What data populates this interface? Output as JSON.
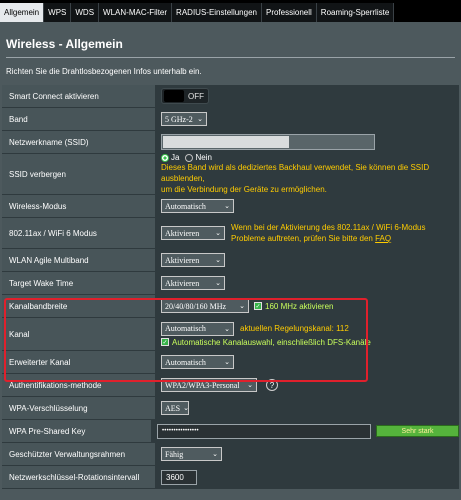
{
  "tabs": [
    "Allgemein",
    "WPS",
    "WDS",
    "WLAN-MAC-Filter",
    "RADIUS-Einstellungen",
    "Professionell",
    "Roaming-Sperrliste"
  ],
  "header": {
    "title": "Wireless - Allgemein",
    "description": "Richten Sie die Drahtlosbezogenen Infos unterhalb ein."
  },
  "rows": {
    "smart_connect": {
      "label": "Smart Connect aktivieren",
      "toggle": "OFF"
    },
    "band": {
      "label": "Band",
      "value": "5 GHz-2"
    },
    "ssid": {
      "label": "Netzwerkname (SSID)",
      "value": ""
    },
    "ssid_hide": {
      "label": "SSID verbergen",
      "opt_ja": "Ja",
      "opt_nein": "Nein",
      "note1": "Dieses Band wird als dediziertes Backhaul verwendet, Sie können die SSID ausblenden,",
      "note2": "um die Verbindung der Geräte zu ermöglichen."
    },
    "wireless_mode": {
      "label": "Wireless-Modus",
      "value": "Automatisch"
    },
    "ax_mode": {
      "label": "802.11ax / WiFi 6 Modus",
      "value": "Aktivieren",
      "note1": "Wenn bei der Aktivierung des 802.11ax / WiFi 6-Modus",
      "note2": "Probleme auftreten, prüfen Sie bitte den ",
      "faq": "FAQ"
    },
    "agile": {
      "label": "WLAN Agile Multiband",
      "value": "Aktivieren"
    },
    "twt": {
      "label": "Target Wake Time",
      "value": "Aktivieren"
    },
    "bandwidth": {
      "label": "Kanalbandbreite",
      "value": "20/40/80/160 MHz",
      "check": "160 MHz aktivieren"
    },
    "channel": {
      "label": "Kanal",
      "value": "Automatisch",
      "info": "aktuellen Regelungskanal: 112",
      "check": "Automatische Kanalauswahl, einschließlich DFS-Kanäle"
    },
    "ext_channel": {
      "label": "Erweiterter Kanal",
      "value": "Automatisch"
    },
    "auth": {
      "label": "Authentifikations-methode",
      "value": "WPA2/WPA3-Personal"
    },
    "wpa_enc": {
      "label": "WPA-Verschlüsselung",
      "value": "AES"
    },
    "psk": {
      "label": "WPA Pre-Shared Key",
      "value": "••••••••••••••••",
      "strength": "Sehr stark"
    },
    "pmf": {
      "label": "Geschützter Verwaltungsrahmen",
      "value": "Fähig"
    },
    "rotation": {
      "label": "Netzwerkschlüssel-Rotationsintervall",
      "value": "3600"
    }
  }
}
